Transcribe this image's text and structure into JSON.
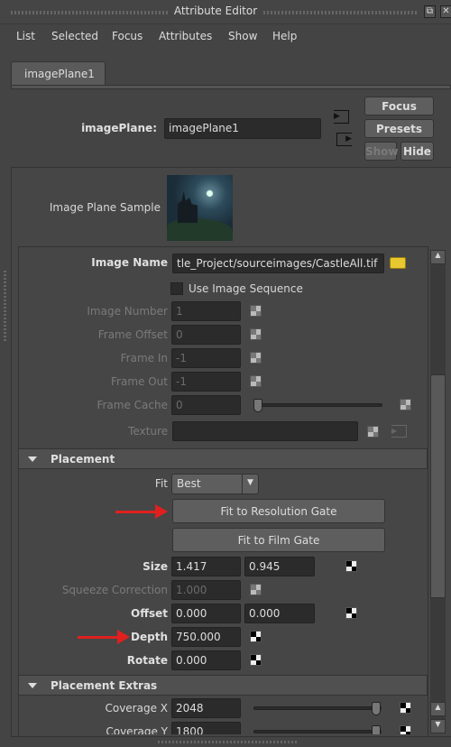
{
  "window": {
    "title": "Attribute Editor"
  },
  "menu": [
    "List",
    "Selected",
    "Focus",
    "Attributes",
    "Show",
    "Help"
  ],
  "tab": {
    "label": "imagePlane1"
  },
  "node": {
    "label": "imagePlane:",
    "value": "imagePlane1"
  },
  "buttons": {
    "focus": "Focus",
    "presets": "Presets",
    "show": "Show",
    "hide": "Hide"
  },
  "sample": {
    "label": "Image Plane Sample"
  },
  "image_name": {
    "label": "Image Name",
    "value": "tle_Project/sourceimages/CastleAll.tif"
  },
  "use_sequence": {
    "label": "Use Image Sequence",
    "checked": false
  },
  "sequence_rows": [
    {
      "label": "Image Number",
      "value": "1"
    },
    {
      "label": "Frame Offset",
      "value": "0"
    },
    {
      "label": "Frame In",
      "value": "-1"
    },
    {
      "label": "Frame Out",
      "value": "-1"
    },
    {
      "label": "Frame Cache",
      "value": "0"
    }
  ],
  "texture": {
    "label": "Texture",
    "value": ""
  },
  "placement": {
    "header": "Placement",
    "fit_label": "Fit",
    "fit_value": "Best",
    "fit_res": "Fit to Resolution Gate",
    "fit_film": "Fit to Film Gate",
    "size": {
      "label": "Size",
      "x": "1.417",
      "y": "0.945"
    },
    "squeeze": {
      "label": "Squeeze Correction",
      "value": "1.000"
    },
    "offset": {
      "label": "Offset",
      "x": "0.000",
      "y": "0.000"
    },
    "depth": {
      "label": "Depth",
      "value": "750.000"
    },
    "rotate": {
      "label": "Rotate",
      "value": "0.000"
    }
  },
  "extras": {
    "header": "Placement Extras",
    "coverage_x": {
      "label": "Coverage X",
      "value": "2048"
    },
    "coverage_y": {
      "label": "Coverage Y",
      "value": "1800"
    }
  },
  "colors": {
    "annotation_arrow": "#e0201e",
    "background": "#444444"
  }
}
